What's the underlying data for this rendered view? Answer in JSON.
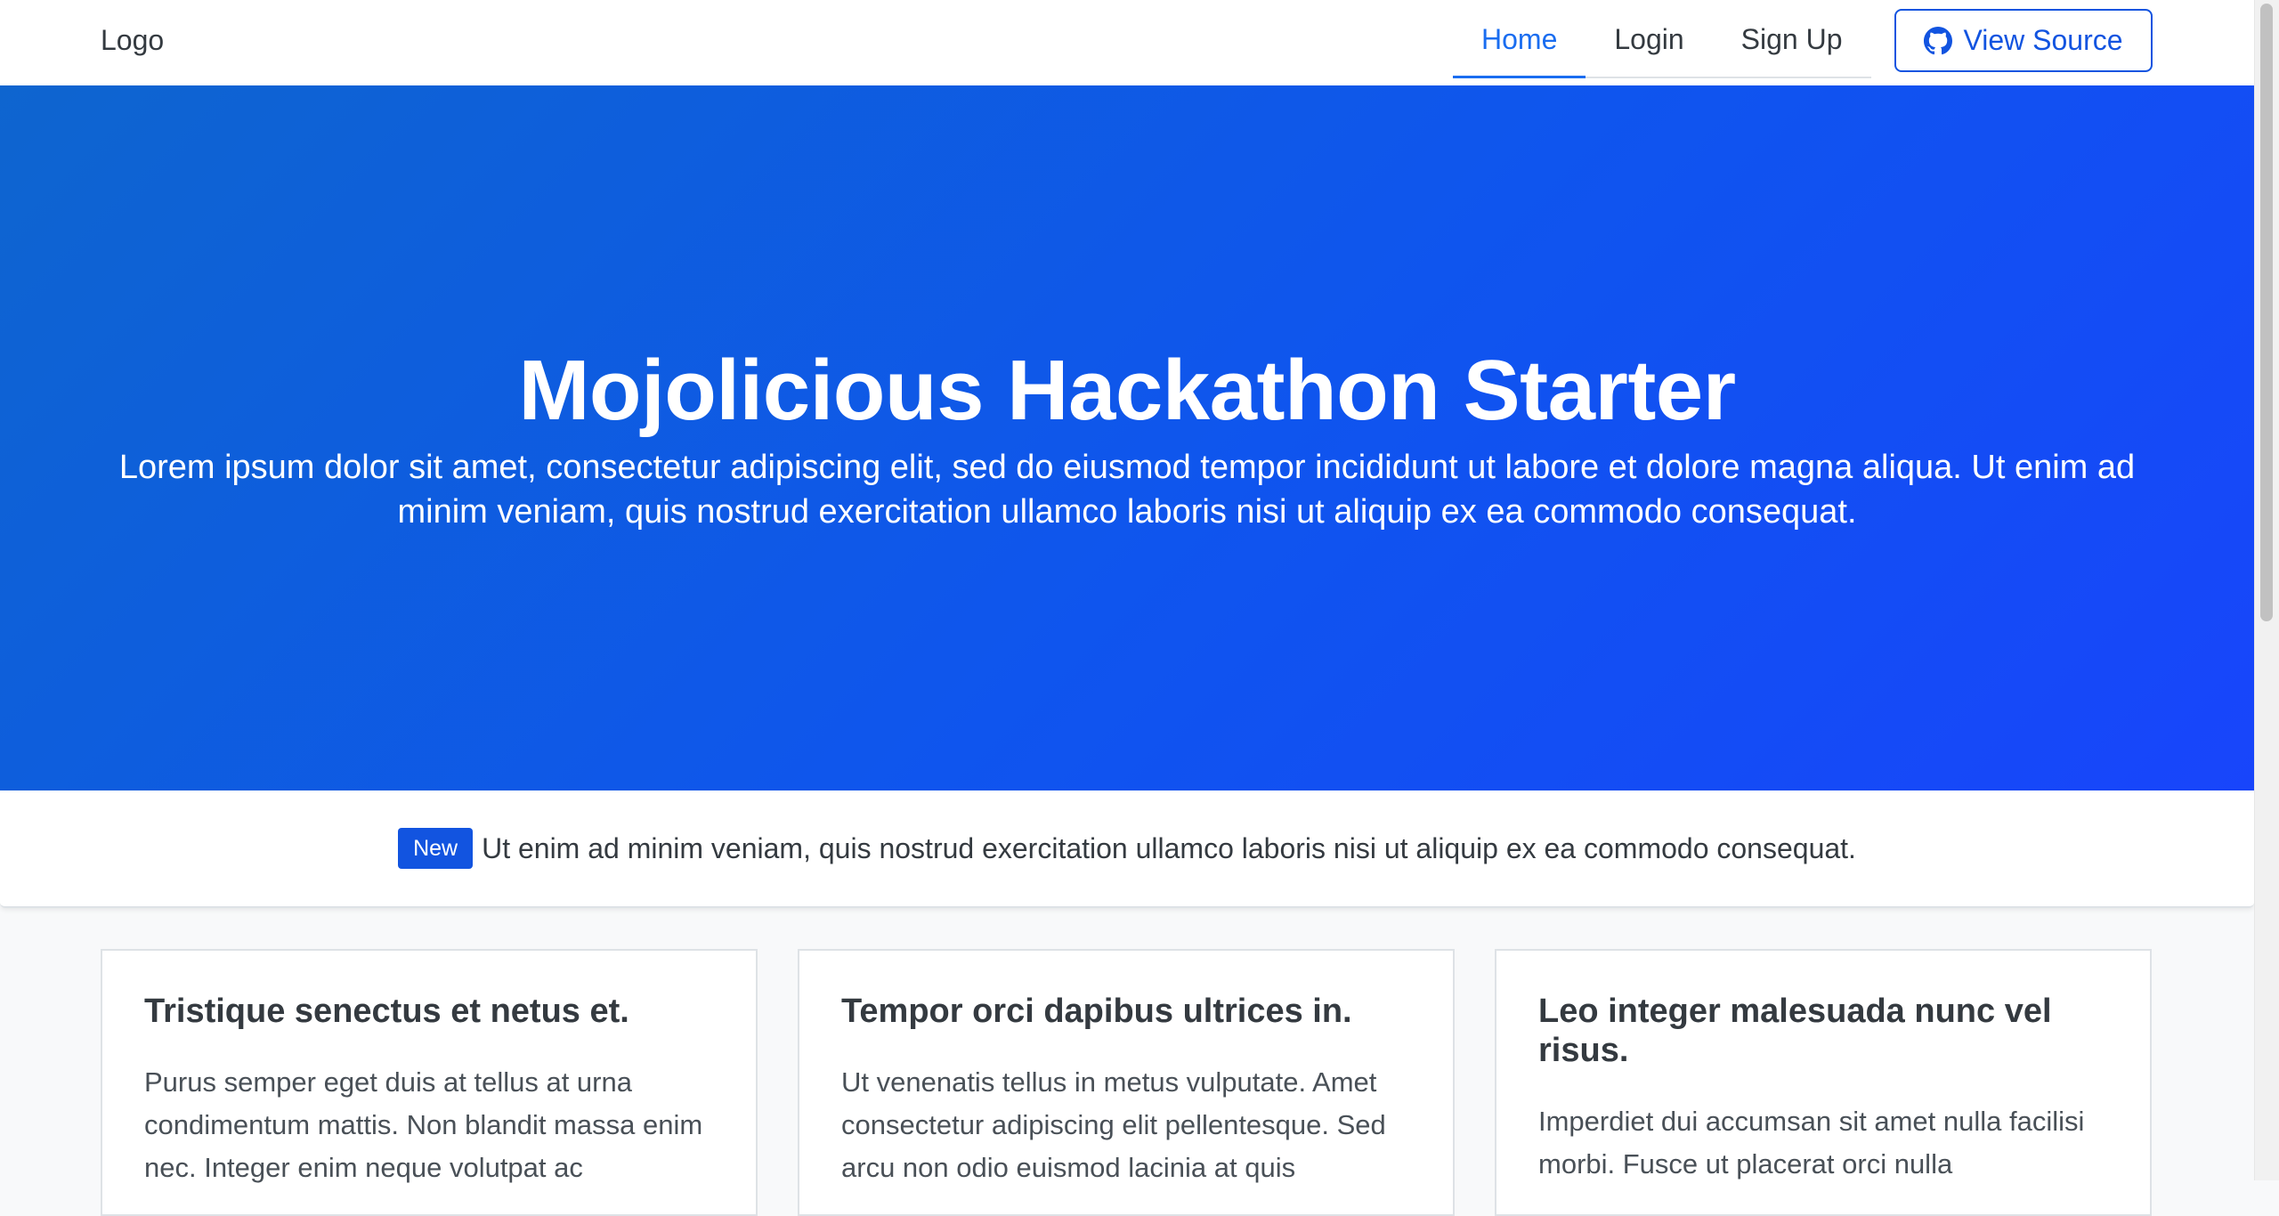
{
  "navbar": {
    "logo": "Logo",
    "links": [
      {
        "label": "Home",
        "active": true
      },
      {
        "label": "Login",
        "active": false
      },
      {
        "label": "Sign Up",
        "active": false
      }
    ],
    "source_button": {
      "label": "View Source",
      "icon": "github-icon"
    }
  },
  "hero": {
    "title": "Mojolicious Hackathon Starter",
    "subtitle": "Lorem ipsum dolor sit amet, consectetur adipiscing elit, sed do eiusmod tempor incididunt ut labore et dolore magna aliqua. Ut enim ad minim veniam, quis nostrud exercitation ullamco laboris nisi ut aliquip ex ea commodo consequat."
  },
  "alert": {
    "badge": "New",
    "text": "Ut enim ad minim veniam, quis nostrud exercitation ullamco laboris nisi ut aliquip ex ea commodo consequat."
  },
  "cards": [
    {
      "title": "Tristique senectus et netus et.",
      "text": "Purus semper eget duis at tellus at urna condimentum mattis. Non blandit massa enim nec. Integer enim neque volutpat ac"
    },
    {
      "title": "Tempor orci dapibus ultrices in.",
      "text": "Ut venenatis tellus in metus vulputate. Amet consectetur adipiscing elit pellentesque. Sed arcu non odio euismod lacinia at quis"
    },
    {
      "title": "Leo integer malesuada nunc vel risus.",
      "text": "Imperdiet dui accumsan sit amet nulla facilisi morbi. Fusce ut placerat orci nulla"
    }
  ],
  "colors": {
    "accent": "#1254e0",
    "hero_gradient_start": "#0e65cf",
    "hero_gradient_end": "#1845fb"
  }
}
